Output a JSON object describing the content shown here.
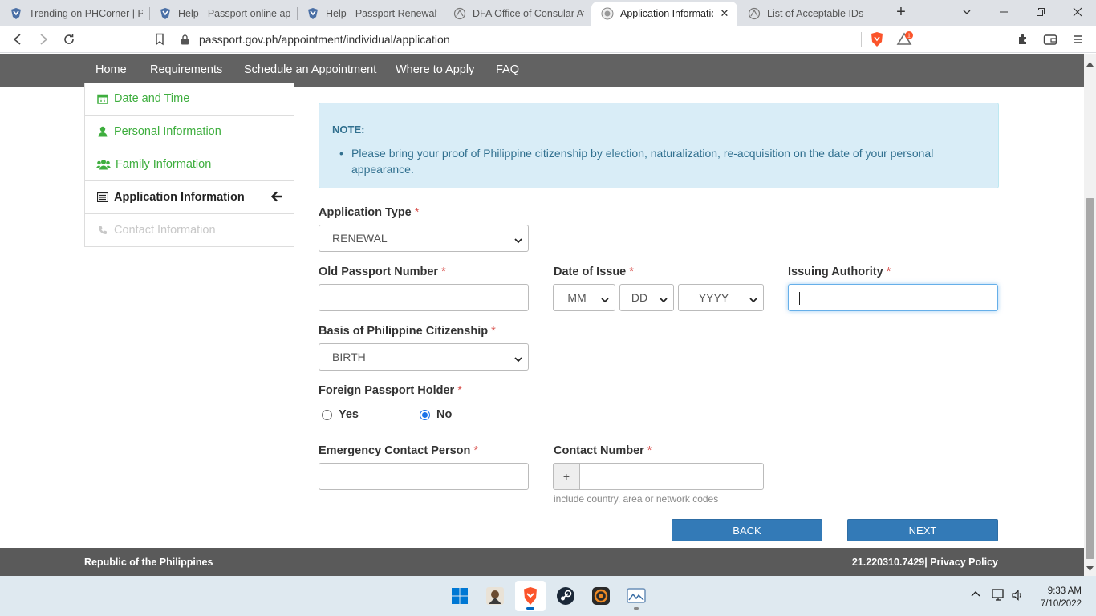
{
  "browser": {
    "tabs": [
      {
        "title": "Trending on PHCorner | Pin"
      },
      {
        "title": "Help - Passport online app"
      },
      {
        "title": "Help - Passport Renewal? |"
      },
      {
        "title": "DFA Office of Consular Affa"
      },
      {
        "title": "Application Information"
      },
      {
        "title": "List of Acceptable IDs"
      }
    ],
    "url": "passport.gov.ph/appointment/individual/application",
    "brave_badge": "1"
  },
  "nav": {
    "items": [
      "Home",
      "Requirements",
      "Schedule an Appointment",
      "Where to Apply",
      "FAQ"
    ]
  },
  "steps": [
    {
      "label": "Date and Time"
    },
    {
      "label": "Personal Information"
    },
    {
      "label": "Family Information"
    },
    {
      "label": "Application Information"
    },
    {
      "label": "Contact Information"
    }
  ],
  "note": {
    "title": "NOTE:",
    "items": [
      "Please bring your proof of Philippine citizenship by election, naturalization, re-acquisition on the date of your personal appearance."
    ]
  },
  "form": {
    "application_type": {
      "label": "Application Type",
      "value": "RENEWAL"
    },
    "old_passport": {
      "label": "Old Passport Number",
      "value": ""
    },
    "date_of_issue": {
      "label": "Date of Issue",
      "month": "MM",
      "day": "DD",
      "year": "YYYY"
    },
    "issuing_authority": {
      "label": "Issuing Authority",
      "value": ""
    },
    "citizenship_basis": {
      "label": "Basis of Philippine Citizenship",
      "value": "BIRTH"
    },
    "foreign_passport": {
      "label": "Foreign Passport Holder",
      "yes": "Yes",
      "no": "No",
      "selected": "No"
    },
    "emergency_contact": {
      "label": "Emergency Contact Person",
      "value": ""
    },
    "contact_number": {
      "label": "Contact Number",
      "prefix": "+",
      "value": "",
      "help": "include country, area or network codes"
    },
    "required_mark": "*",
    "back_label": "BACK",
    "next_label": "NEXT"
  },
  "footer": {
    "left": "Republic of the Philippines",
    "right": "21.220310.7429| Privacy Policy"
  },
  "taskbar": {
    "time": "9:33 AM",
    "date": "7/10/2022"
  },
  "colors": {
    "navbar": "#626262",
    "step_green": "#3eae3e",
    "note_bg": "#d9edf7",
    "note_text": "#31708f",
    "button": "#337ab7",
    "required": "#d9534f",
    "footer": "#5a5a5a"
  },
  "icons": [
    "chrome-back-icon",
    "chrome-forward-icon",
    "reload-icon",
    "bookmark-icon",
    "lock-icon",
    "brave-shield-icon",
    "brave-rewards-icon",
    "extensions-icon",
    "wallet-icon",
    "menu-icon",
    "calendar-icon",
    "user-icon",
    "users-icon",
    "list-icon",
    "phone-icon",
    "arrow-left-icon"
  ]
}
